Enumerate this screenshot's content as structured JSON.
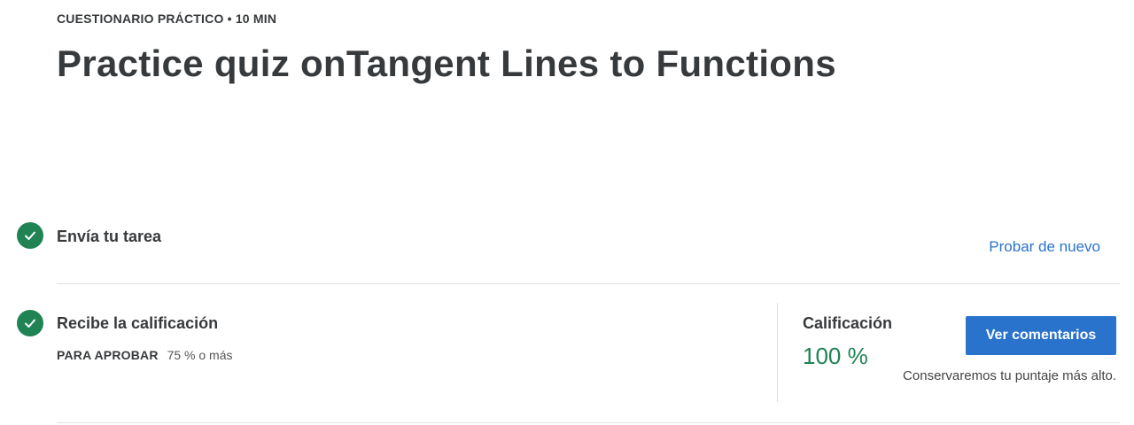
{
  "header": {
    "eyebrow": "CUESTIONARIO PRÁCTICO • 10 MIN",
    "title": "Practice quiz onTangent Lines to Functions"
  },
  "steps": [
    {
      "title": "Envía tu tarea",
      "completed": true,
      "action_label": "Probar de nuevo"
    },
    {
      "title": "Recibe la calificación",
      "completed": true,
      "pass_label": "PARA APROBAR",
      "pass_value": "75 % o más"
    }
  ],
  "grade": {
    "label": "Calificación",
    "value": "100 %",
    "button_label": "Ver comentarios",
    "note": "Conservaremos tu puntaje más alto."
  },
  "colors": {
    "success": "#1f8354",
    "accent": "#2a73cc"
  },
  "icons": {
    "check": "check-circle-icon"
  }
}
